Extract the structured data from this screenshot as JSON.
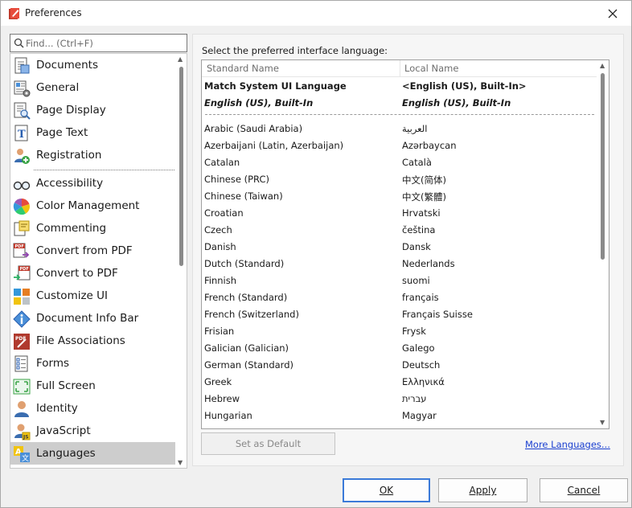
{
  "window": {
    "title": "Preferences"
  },
  "search": {
    "placeholder": "Find... (Ctrl+F)"
  },
  "nav": {
    "items": [
      {
        "label": "Documents",
        "icon": "documents-icon"
      },
      {
        "label": "General",
        "icon": "general-icon"
      },
      {
        "label": "Page Display",
        "icon": "page-display-icon"
      },
      {
        "label": "Page Text",
        "icon": "page-text-icon"
      },
      {
        "label": "Registration",
        "icon": "registration-icon"
      },
      {
        "label": "Accessibility",
        "icon": "accessibility-glasses-icon"
      },
      {
        "label": "Color Management",
        "icon": "color-management-icon"
      },
      {
        "label": "Commenting",
        "icon": "commenting-icon"
      },
      {
        "label": "Convert from PDF",
        "icon": "convert-from-pdf-icon"
      },
      {
        "label": "Convert to PDF",
        "icon": "convert-to-pdf-icon"
      },
      {
        "label": "Customize UI",
        "icon": "customize-ui-icon"
      },
      {
        "label": "Document Info Bar",
        "icon": "info-icon"
      },
      {
        "label": "File Associations",
        "icon": "file-associations-icon"
      },
      {
        "label": "Forms",
        "icon": "forms-icon"
      },
      {
        "label": "Full Screen",
        "icon": "full-screen-icon"
      },
      {
        "label": "Identity",
        "icon": "identity-icon"
      },
      {
        "label": "JavaScript",
        "icon": "javascript-icon"
      },
      {
        "label": "Languages",
        "icon": "languages-icon"
      }
    ],
    "selected": "Languages"
  },
  "languages": {
    "prompt": "Select the preferred interface language:",
    "col_standard": "Standard Name",
    "col_local": "Local Name",
    "pinned": [
      {
        "standard": "Match System UI Language",
        "local": "<English (US), Built-In>"
      },
      {
        "standard": "English (US), Built-In",
        "local": "English (US), Built-In"
      }
    ],
    "rows": [
      {
        "standard": "Arabic (Saudi Arabia)",
        "local": "العربية"
      },
      {
        "standard": "Azerbaijani (Latin, Azerbaijan)",
        "local": "Azərbaycan"
      },
      {
        "standard": "Catalan",
        "local": "Català"
      },
      {
        "standard": "Chinese (PRC)",
        "local": "中文(简体)"
      },
      {
        "standard": "Chinese (Taiwan)",
        "local": "中文(繁體)"
      },
      {
        "standard": "Croatian",
        "local": "Hrvatski"
      },
      {
        "standard": "Czech",
        "local": "čeština"
      },
      {
        "standard": "Danish",
        "local": "Dansk"
      },
      {
        "standard": "Dutch (Standard)",
        "local": "Nederlands"
      },
      {
        "standard": "Finnish",
        "local": "suomi"
      },
      {
        "standard": "French (Standard)",
        "local": "français"
      },
      {
        "standard": "French (Switzerland)",
        "local": "Français Suisse"
      },
      {
        "standard": "Frisian",
        "local": "Frysk"
      },
      {
        "standard": "Galician (Galician)",
        "local": "Galego"
      },
      {
        "standard": "German (Standard)",
        "local": "Deutsch"
      },
      {
        "standard": "Greek",
        "local": "Ελληνικά"
      },
      {
        "standard": "Hebrew",
        "local": "עברית"
      },
      {
        "standard": "Hungarian",
        "local": "Magyar"
      }
    ],
    "set_default_label": "Set as Default",
    "more_languages_label": "More Languages..."
  },
  "buttons": {
    "ok": "OK",
    "apply": "Apply",
    "cancel": "Cancel"
  }
}
